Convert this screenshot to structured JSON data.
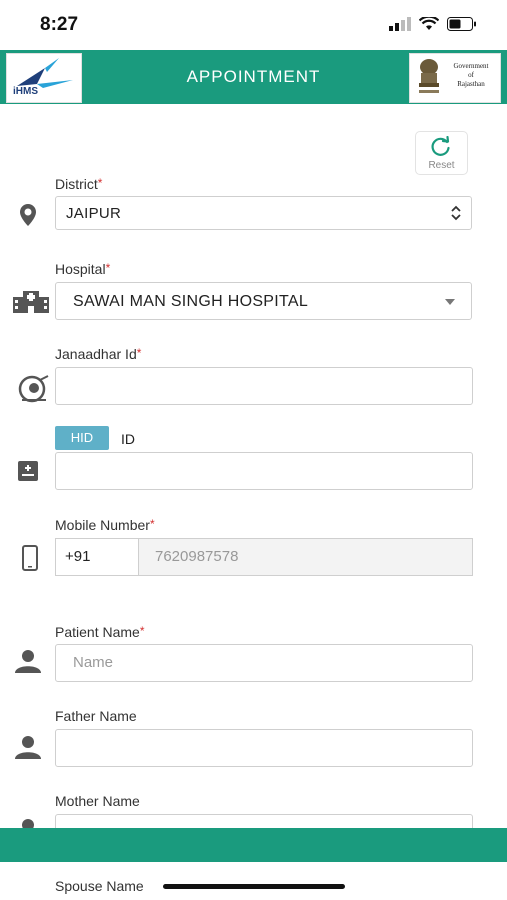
{
  "status_bar": {
    "time": "8:27"
  },
  "header": {
    "title": "APPOINTMENT",
    "logo_text": "iHMS",
    "gov_text_line1": "Government",
    "gov_text_line2": "of",
    "gov_text_line3": "Rajasthan"
  },
  "reset": {
    "label": "Reset"
  },
  "form": {
    "district": {
      "label": "District",
      "required": "*",
      "value": "JAIPUR"
    },
    "hospital": {
      "label": "Hospital",
      "required": "*",
      "value": "SAWAI MAN SINGH HOSPITAL"
    },
    "janaadhar": {
      "label": "Janaadhar Id",
      "required": "*",
      "value": ""
    },
    "hid": {
      "tab_hid": "HID",
      "tab_id": "ID",
      "value": ""
    },
    "mobile": {
      "label": "Mobile Number",
      "required": "*",
      "country_code": "+91",
      "value": "7620987578"
    },
    "patient_name": {
      "label": "Patient Name",
      "required": "*",
      "placeholder": "Name"
    },
    "father_name": {
      "label": "Father Name",
      "value": ""
    },
    "mother_name": {
      "label": "Mother Name",
      "value": ""
    },
    "spouse_name": {
      "label": "Spouse Name"
    }
  },
  "colors": {
    "brand": "#1a9b7e",
    "tab_active": "#5fb0c8",
    "required": "#d32f2f"
  }
}
